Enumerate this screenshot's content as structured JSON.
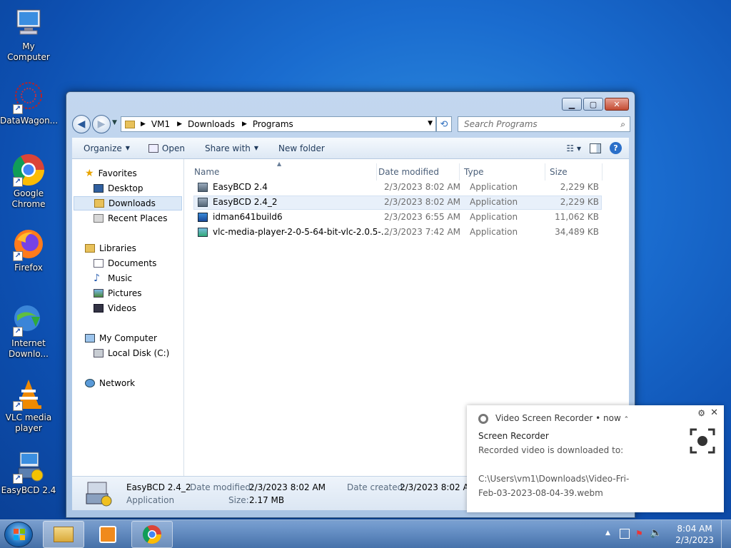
{
  "desktop": {
    "icons": [
      {
        "label": "My Computer"
      },
      {
        "label": "DataWagon..."
      },
      {
        "label": "Google Chrome"
      },
      {
        "label": "Firefox"
      },
      {
        "label": "Internet Downlo..."
      },
      {
        "label": "VLC media player"
      },
      {
        "label": "EasyBCD 2.4"
      }
    ]
  },
  "window": {
    "address": [
      "VM1",
      "Downloads",
      "Programs"
    ],
    "search_placeholder": "Search Programs",
    "toolbar": {
      "organize": "Organize",
      "open": "Open",
      "share_with": "Share with",
      "new_folder": "New folder"
    },
    "nav": {
      "favorites": "Favorites",
      "desktop": "Desktop",
      "downloads": "Downloads",
      "recent": "Recent Places",
      "libraries": "Libraries",
      "documents": "Documents",
      "music": "Music",
      "pictures": "Pictures",
      "videos": "Videos",
      "my_computer": "My Computer",
      "local_disk": "Local Disk (C:)",
      "network": "Network"
    },
    "columns": {
      "name": "Name",
      "date": "Date modified",
      "type": "Type",
      "size": "Size"
    },
    "files": [
      {
        "name": "EasyBCD 2.4",
        "date": "2/3/2023 8:02 AM",
        "type": "Application",
        "size": "2,229 KB"
      },
      {
        "name": "EasyBCD 2.4_2",
        "date": "2/3/2023 8:02 AM",
        "type": "Application",
        "size": "2,229 KB"
      },
      {
        "name": "idman641build6",
        "date": "2/3/2023 6:55 AM",
        "type": "Application",
        "size": "11,062 KB"
      },
      {
        "name": "vlc-media-player-2-0-5-64-bit-vlc-2.0.5-...",
        "date": "2/3/2023 7:42 AM",
        "type": "Application",
        "size": "34,489 KB"
      }
    ],
    "details": {
      "name": "EasyBCD 2.4_2",
      "type": "Application",
      "modified_label": "Date modified:",
      "modified": "2/3/2023 8:02 AM",
      "size_label": "Size:",
      "size": "2.17 MB",
      "created_label": "Date created:",
      "created": "2/3/2023 8:02 AM"
    }
  },
  "notification": {
    "app": "Video Screen Recorder",
    "when": "now",
    "title": "Screen Recorder",
    "body": "Recorded video is downloaded to:",
    "path_line1": "C:\\Users\\vm1\\Downloads\\Video-Fri-",
    "path_line2": "Feb-03-2023-08-04-39.webm"
  },
  "taskbar": {
    "time": "8:04 AM",
    "date": "2/3/2023"
  }
}
